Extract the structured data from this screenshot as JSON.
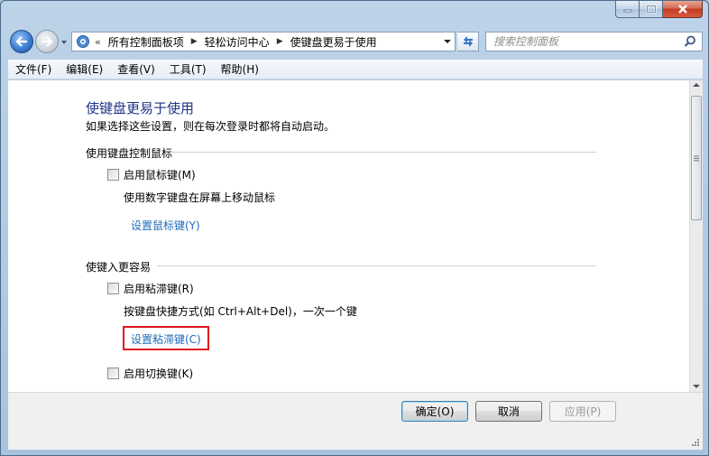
{
  "window": {
    "caption_icons": [
      "minimize-icon",
      "maximize-icon",
      "close-icon"
    ]
  },
  "nav": {
    "breadcrumb_lead": "«",
    "crumbs": [
      "所有控制面板项",
      "轻松访问中心",
      "使键盘更易于使用"
    ],
    "search_placeholder": "搜索控制面板"
  },
  "menu": [
    "文件(F)",
    "编辑(E)",
    "查看(V)",
    "工具(T)",
    "帮助(H)"
  ],
  "page": {
    "title": "使键盘更易于使用",
    "description": "如果选择这些设置，则在每次登录时都将自动启动。",
    "sections": [
      {
        "heading": "使用键盘控制鼠标",
        "checkbox_label": "启用鼠标键(M)",
        "checked": false,
        "desc": "使用数字键盘在屏幕上移动鼠标",
        "link": "设置鼠标键(Y)"
      },
      {
        "heading": "使键入更容易",
        "checkbox_label": "启用粘滞键(R)",
        "checked": false,
        "desc": "按键盘快捷方式(如 Ctrl+Alt+Del)，一次一个键",
        "link": "设置粘滞键(C)"
      }
    ],
    "extra_checkbox_label": "启用切换键(K)"
  },
  "footer": {
    "ok": "确定(O)",
    "cancel": "取消",
    "apply": "应用(P)"
  },
  "colors": {
    "title": "#1e3287",
    "link": "#1e6ab8",
    "highlight": "#e0141e"
  }
}
